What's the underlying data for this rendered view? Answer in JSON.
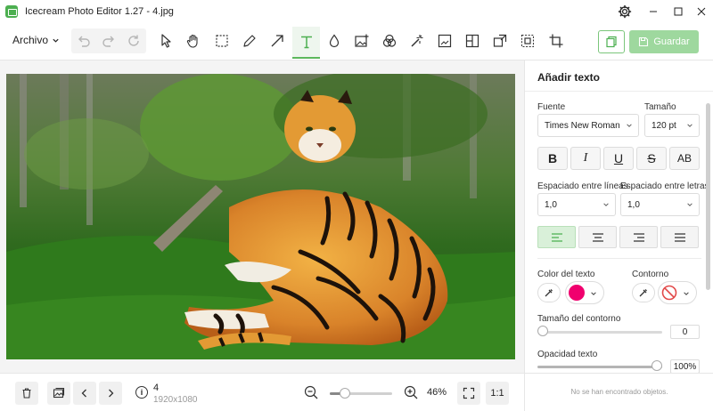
{
  "window": {
    "title": "Icecream Photo Editor 1.27 - 4.jpg"
  },
  "toolbar": {
    "menu_label": "Archivo",
    "save_label": "Guardar",
    "active_tool": "text-tool"
  },
  "panel": {
    "title": "Añadir texto",
    "font_label": "Fuente",
    "font_value": "Times New Roman",
    "size_label": "Tamaño",
    "size_value": "120 pt",
    "format_buttons": [
      "B",
      "I",
      "U",
      "S",
      "AB"
    ],
    "line_spacing_label": "Espaciado entre líneas",
    "line_spacing_value": "1,0",
    "letter_spacing_label": "Espaciado entre letras",
    "letter_spacing_value": "1,0",
    "text_color_label": "Color del texto",
    "text_color": "#f0006e",
    "outline_label": "Contorno",
    "outline_size_label": "Tamaño del contorno",
    "outline_size_value": "0",
    "opacity_label": "Opacidad texto",
    "opacity_value": "100%",
    "no_objects": "No se han encontrado objetos."
  },
  "status": {
    "image_index": "4",
    "image_dims": "1920x1080",
    "zoom_level": "46%",
    "zoom_fraction": 0.24,
    "one_to_one": "1:1"
  },
  "colors": {
    "accent_green": "#5cb85c",
    "save_disabled": "#9ed89e",
    "text_color_swatch": "#f0006e"
  }
}
